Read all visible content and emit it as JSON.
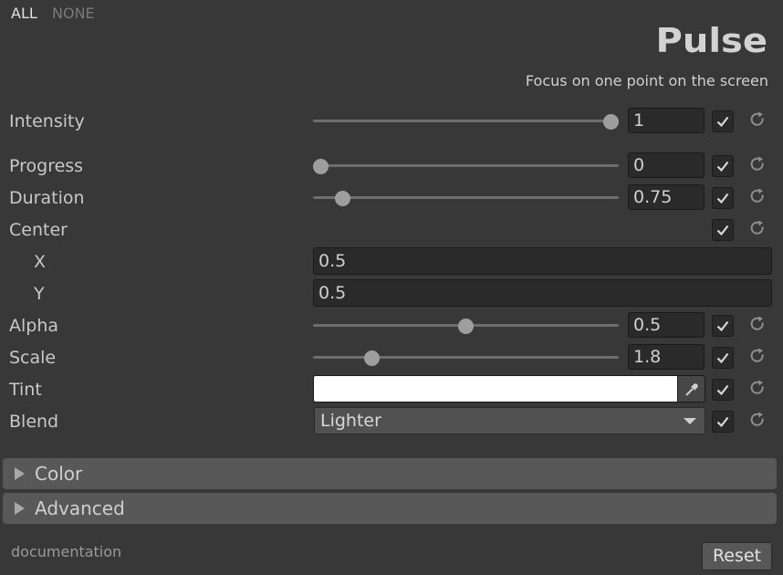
{
  "header": {
    "all_label": "ALL",
    "none_label": "NONE",
    "title": "Pulse",
    "subtitle": "Focus on one point on the screen"
  },
  "params": {
    "intensity": {
      "label": "Intensity",
      "value": "1",
      "slider_fraction": 1.0,
      "enabled": true
    },
    "progress": {
      "label": "Progress",
      "value": "0",
      "slider_fraction": 0.0,
      "enabled": true
    },
    "duration": {
      "label": "Duration",
      "value": "0.75",
      "slider_fraction": 0.1,
      "enabled": true
    },
    "center": {
      "label": "Center",
      "enabled": true,
      "x_label": "X",
      "x_value": "0.5",
      "y_label": "Y",
      "y_value": "0.5"
    },
    "alpha": {
      "label": "Alpha",
      "value": "0.5",
      "slider_fraction": 0.5,
      "enabled": true
    },
    "scale": {
      "label": "Scale",
      "value": "1.8",
      "slider_fraction": 0.2,
      "enabled": true
    },
    "tint": {
      "label": "Tint",
      "color": "#ffffff",
      "enabled": true
    },
    "blend": {
      "label": "Blend",
      "value": "Lighter",
      "enabled": true
    }
  },
  "sections": {
    "color_label": "Color",
    "advanced_label": "Advanced"
  },
  "footer": {
    "documentation_label": "documentation",
    "reset_label": "Reset"
  },
  "icons": {
    "check": "check-icon",
    "reset": "reset-icon",
    "eyedropper": "eyedropper-icon",
    "fold": "triangle-right-icon"
  }
}
